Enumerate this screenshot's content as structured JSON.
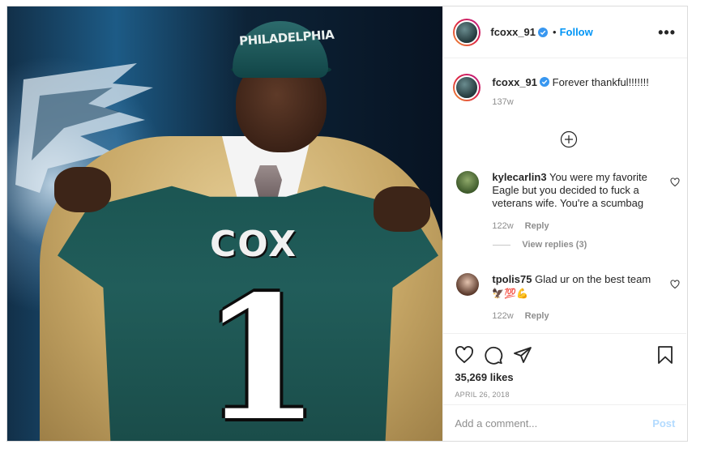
{
  "photo": {
    "cap_text": "PHILADELPHIA",
    "jersey_name": "COX",
    "jersey_number": "1"
  },
  "header": {
    "username": "fcoxx_91",
    "separator": "•",
    "follow_label": "Follow",
    "more_label": "•••"
  },
  "caption": {
    "username": "fcoxx_91",
    "text": "Forever thankful!!!!!!!",
    "age": "137w"
  },
  "comments": [
    {
      "username": "kylecarlin3",
      "text": "You were my favorite Eagle but you decided to fuck a veterans wife. You're a scumbag",
      "age": "122w",
      "reply_label": "Reply",
      "view_replies": "View replies (3)"
    },
    {
      "username": "tpolis75",
      "text": "Glad ur on the best team",
      "emoji": "🦅💯💪",
      "age": "122w",
      "reply_label": "Reply"
    }
  ],
  "likes": "35,269 likes",
  "date": "APRIL 26, 2018",
  "add_comment": {
    "placeholder": "Add a comment...",
    "post_label": "Post"
  },
  "colors": {
    "link_blue": "#0095f6",
    "post_disabled": "#b3dbff",
    "muted": "#8e8e8e"
  },
  "icons": [
    "heart-icon",
    "comment-icon",
    "share-icon",
    "bookmark-icon",
    "plus-circle-icon",
    "verified-badge-icon",
    "more-options-icon"
  ]
}
